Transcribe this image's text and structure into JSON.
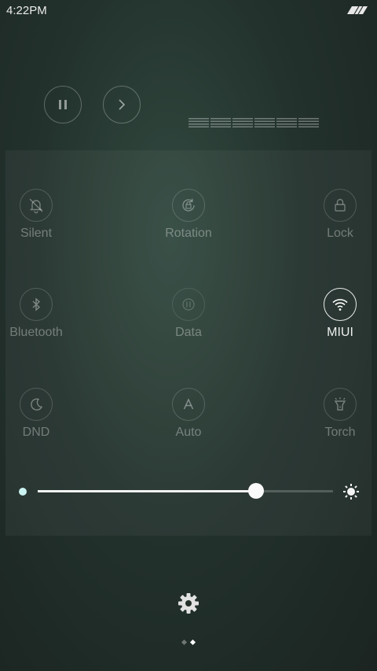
{
  "status_bar": {
    "time": "4:22PM",
    "signal_icon": "signal-icon"
  },
  "media": {
    "pause_icon": "pause-icon",
    "next_icon": "chevron-right-icon",
    "equalizer_icon": "equalizer-icon"
  },
  "tiles": [
    {
      "label": "Silent",
      "icon": "bell-off-icon",
      "active": false
    },
    {
      "label": "Rotation",
      "icon": "rotation-lock-icon",
      "active": false
    },
    {
      "label": "Lock",
      "icon": "lock-icon",
      "active": false
    },
    {
      "label": "Bluetooth",
      "icon": "bluetooth-icon",
      "active": false
    },
    {
      "label": "Data",
      "icon": "data-icon",
      "active": false
    },
    {
      "label": "MIUI",
      "icon": "wifi-icon",
      "active": true
    },
    {
      "label": "DND",
      "icon": "moon-icon",
      "active": false
    },
    {
      "label": "Auto",
      "icon": "auto-brightness-icon",
      "active": false
    },
    {
      "label": "Torch",
      "icon": "flashlight-icon",
      "active": false
    }
  ],
  "brightness": {
    "level_percent": 74,
    "min_icon": "dim-icon",
    "max_icon": "sun-icon"
  },
  "footer": {
    "settings_icon": "gear-icon",
    "pages": 2,
    "current_page": 2
  },
  "colors": {
    "accent_dot": "#c9f2f0",
    "active": "#ffffff"
  }
}
